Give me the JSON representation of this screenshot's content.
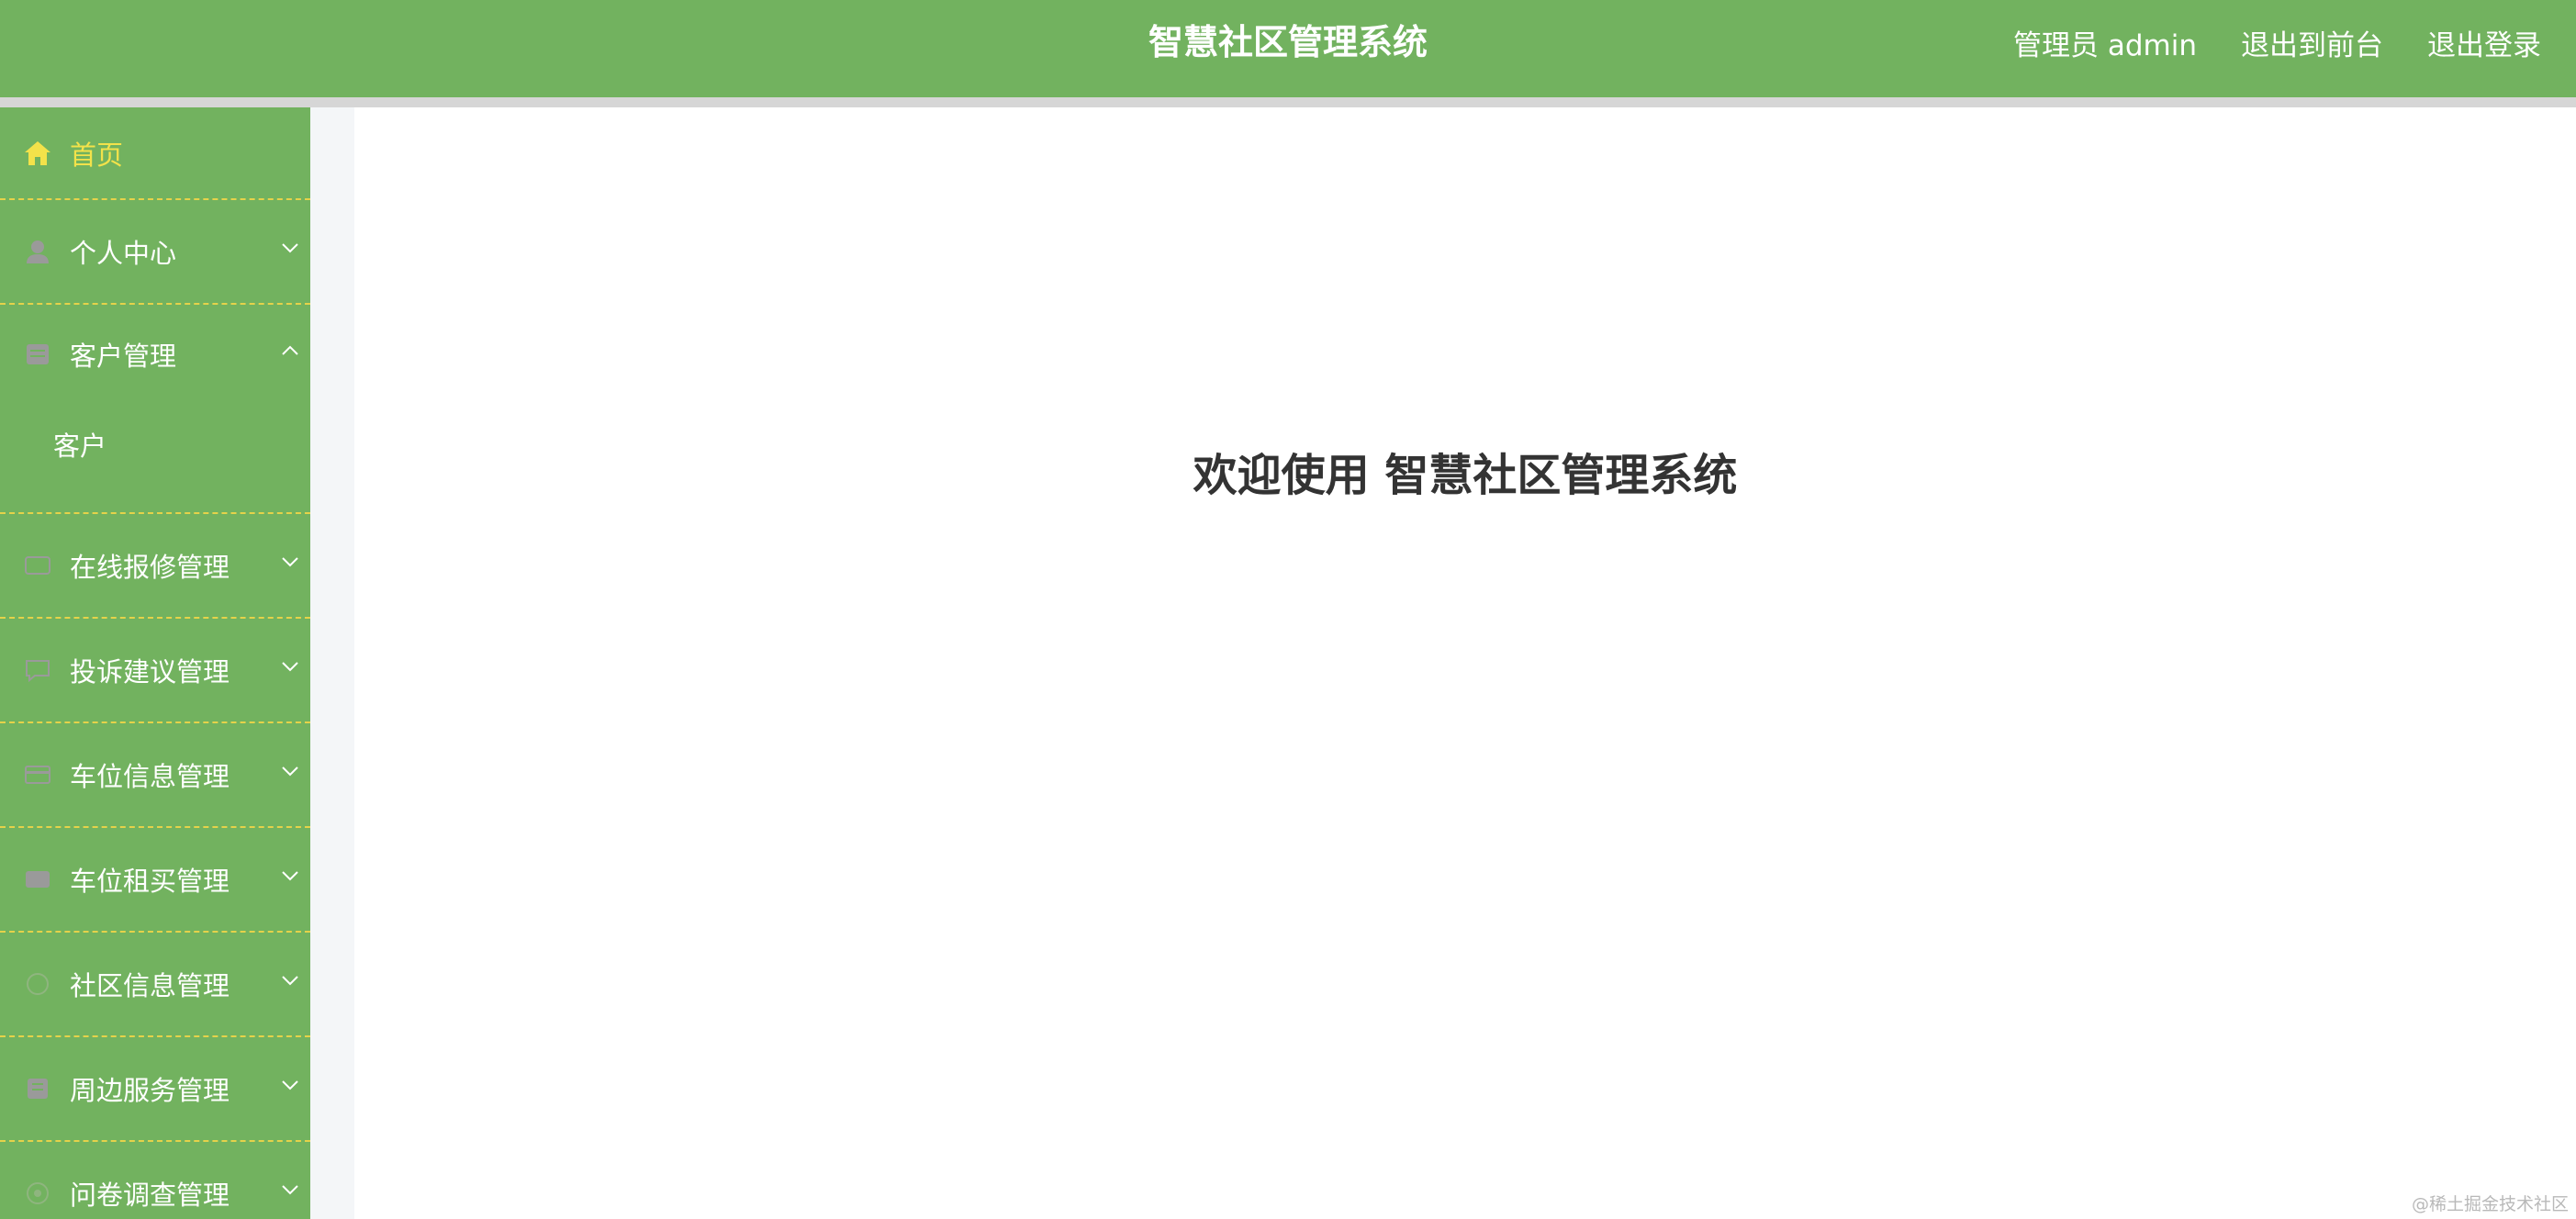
{
  "header": {
    "title": "智慧社区管理系统",
    "links": [
      {
        "label": "管理员 admin"
      },
      {
        "label": "退出到前台"
      },
      {
        "label": "退出登录"
      }
    ]
  },
  "sidebar": {
    "items": [
      {
        "label": "首页",
        "icon": "home-icon",
        "active": true
      },
      {
        "label": "个人中心",
        "icon": "user-icon"
      },
      {
        "label": "客户管理",
        "icon": "customer-icon",
        "expanded": true,
        "children": [
          {
            "label": "客户"
          }
        ]
      },
      {
        "label": "在线报修管理",
        "icon": "repair-icon"
      },
      {
        "label": "投诉建议管理",
        "icon": "complaint-icon"
      },
      {
        "label": "车位信息管理",
        "icon": "parking-icon"
      },
      {
        "label": "车位租买管理",
        "icon": "rent-icon"
      },
      {
        "label": "社区信息管理",
        "icon": "community-icon"
      },
      {
        "label": "周边服务管理",
        "icon": "service-icon"
      },
      {
        "label": "问卷调查管理",
        "icon": "survey-icon"
      }
    ]
  },
  "main": {
    "welcome": "欢迎使用 智慧社区管理系统"
  },
  "watermark": "@稀土掘金技术社区",
  "colors": {
    "brand_green": "#72b25f",
    "active_yellow": "#f3e24a",
    "divider_yellow": "#e5d24a",
    "icon_gray": "#9a9a9a"
  }
}
